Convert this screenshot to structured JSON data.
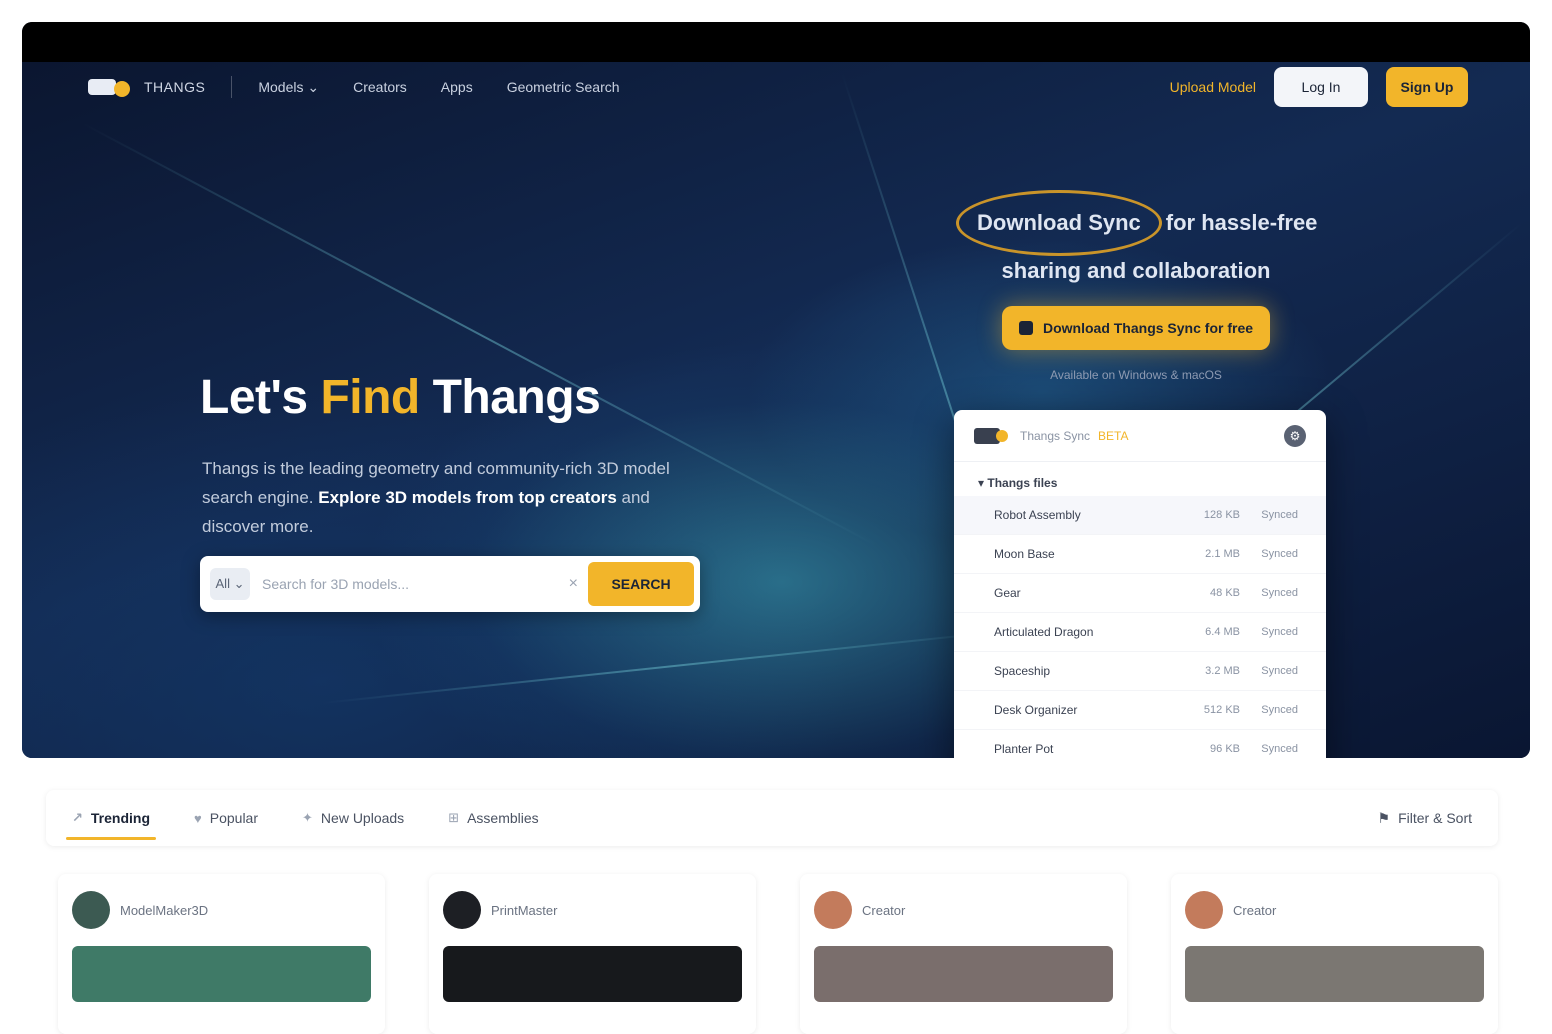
{
  "nav": {
    "logo_text": "THANGS",
    "links": [
      "Models ⌄",
      "Creators",
      "Apps",
      "Geometric Search"
    ],
    "upload": "Upload Model",
    "login": "Log In",
    "signup": "Sign Up"
  },
  "hero": {
    "title_pre": "Let's ",
    "title_hl": "Find",
    "title_post": " Thangs",
    "subtitle_pre": "Thangs is the leading geometry and community-rich 3D model search engine. ",
    "subtitle_bold": "Explore 3D models from top creators",
    "subtitle_post": " and discover more."
  },
  "search": {
    "category": "All ⌄",
    "placeholder": "Search for 3D models...",
    "clear": "×",
    "button": "SEARCH"
  },
  "promo": {
    "circled": "Download Sync",
    "line1_rest": "for hassle-free",
    "line2": "sharing and collaboration",
    "button": "Download Thangs Sync for free",
    "note": "Available on Windows & macOS"
  },
  "app": {
    "title": "Thangs Sync",
    "title_hl": "BETA",
    "gear": "⚙",
    "section": "▾ Thangs files",
    "rows": [
      {
        "name": "Robot Assembly",
        "a": "128 KB",
        "b": "Synced"
      },
      {
        "name": "Moon Base",
        "a": "2.1 MB",
        "b": "Synced"
      },
      {
        "name": "Gear",
        "a": "48 KB",
        "b": "Synced"
      },
      {
        "name": "Articulated Dragon",
        "a": "6.4 MB",
        "b": "Synced"
      },
      {
        "name": "Spaceship",
        "a": "3.2 MB",
        "b": "Synced"
      },
      {
        "name": "Desk Organizer",
        "a": "512 KB",
        "b": "Synced"
      },
      {
        "name": "Planter Pot",
        "a": "96 KB",
        "b": "Synced"
      }
    ]
  },
  "tabs": {
    "items": [
      {
        "icon": "↗",
        "label": "Trending"
      },
      {
        "icon": "♥",
        "label": "Popular"
      },
      {
        "icon": "✦",
        "label": "New Uploads"
      },
      {
        "icon": "⊞",
        "label": "Assemblies"
      }
    ],
    "right_icon": "⚑",
    "right_label": "Filter & Sort"
  },
  "cards": [
    {
      "user": "ModelMaker3D",
      "avatar_color": "#3c5a52",
      "thumb_color": "#3f7a67"
    },
    {
      "user": "PrintMaster",
      "avatar_color": "#1d1f24",
      "thumb_color": "#17191c"
    },
    {
      "user": "Creator",
      "avatar_color": "#c37b5c",
      "thumb_color": "#7a6e6c"
    },
    {
      "user": "Creator",
      "avatar_color": "#c37b5c",
      "thumb_color": "#7b7772"
    }
  ],
  "colors": {
    "accent": "#f2b52a",
    "hero_bg": "#0e1a33"
  }
}
